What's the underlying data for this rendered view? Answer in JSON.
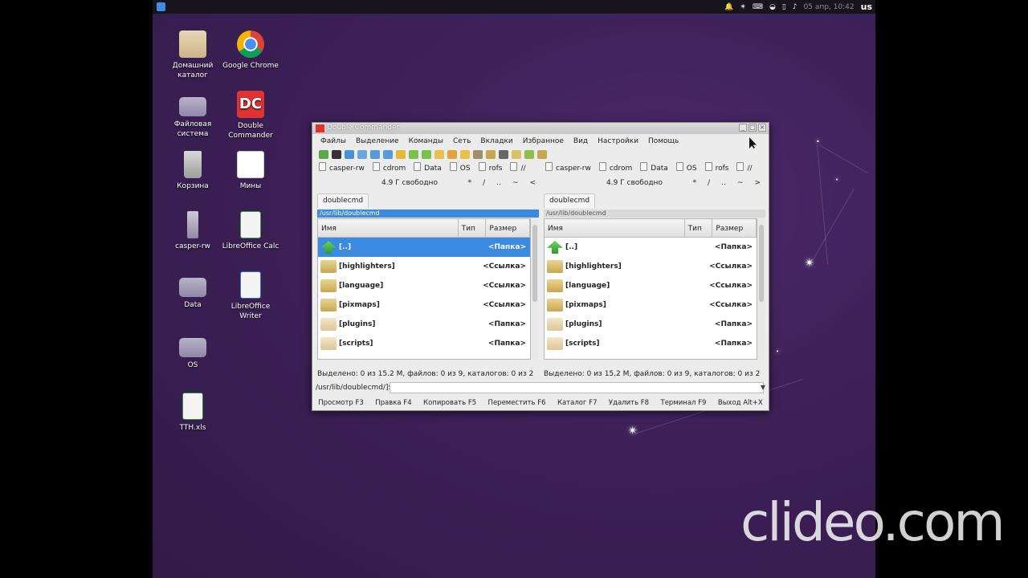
{
  "topbar": {
    "clock": "05 апр, 10:42",
    "lang": "us",
    "tray_icons": [
      "bell-icon",
      "bluetooth-icon",
      "keyboard-icon",
      "wifi-icon",
      "battery-icon",
      "volume-icon"
    ]
  },
  "desktop": {
    "icons": [
      {
        "label": "Домашний каталог",
        "icon": "home-folder-icon"
      },
      {
        "label": "Google Chrome",
        "icon": "chrome-icon"
      },
      {
        "label": "Файловая система",
        "icon": "drive-icon"
      },
      {
        "label": "Double Commander",
        "icon": "double-commander-icon"
      },
      {
        "label": "Корзина",
        "icon": "trash-icon"
      },
      {
        "label": "Мины",
        "icon": "mines-icon"
      },
      {
        "label": "casper-rw",
        "icon": "usb-icon"
      },
      {
        "label": "LibreOffice Calc",
        "icon": "calc-icon"
      },
      {
        "label": "Data",
        "icon": "drive-icon"
      },
      {
        "label": "LibreOffice Writer",
        "icon": "writer-icon"
      },
      {
        "label": "OS",
        "icon": "drive-icon"
      },
      {
        "label": "TTH.xls",
        "icon": "xls-icon"
      }
    ]
  },
  "window": {
    "title": "Double Commander",
    "menu": [
      "Файлы",
      "Выделение",
      "Команды",
      "Сеть",
      "Вкладки",
      "Избранное",
      "Вид",
      "Настройки",
      "Помощь"
    ],
    "drives": [
      "casper-rw",
      "cdrom",
      "Data",
      "OS",
      "rofs",
      "//"
    ],
    "free_space": "4.9 Г свободно",
    "nav": [
      "*",
      "/",
      "..",
      "~",
      "<"
    ],
    "nav_right": [
      "*",
      "/",
      "..",
      "~",
      ">"
    ],
    "left": {
      "tab": "doublecmd",
      "path": "/usr/lib/doublecmd",
      "status": "Выделено: 0 из 15.2 M, файлов: 0 из 9, каталогов: 0 из 2"
    },
    "right": {
      "tab": "doublecmd",
      "path": "/usr/lib/doublecmd",
      "status": "Выделено: 0 из 15.2 M, файлов: 0 из 9, каталогов: 0 из 2"
    },
    "columns": {
      "name": "Имя",
      "type": "Тип",
      "size": "Размер"
    },
    "rows": [
      {
        "name": "[..]",
        "kind": "<Папка>",
        "icon": "up-icon"
      },
      {
        "name": "[highlighters]",
        "kind": "<Ссылка>",
        "icon": "link-folder-icon"
      },
      {
        "name": "[language]",
        "kind": "<Ссылка>",
        "icon": "link-folder-icon"
      },
      {
        "name": "[pixmaps]",
        "kind": "<Ссылка>",
        "icon": "link-folder-icon"
      },
      {
        "name": "[plugins]",
        "kind": "<Папка>",
        "icon": "folder-icon"
      },
      {
        "name": "[scripts]",
        "kind": "<Папка>",
        "icon": "folder-icon"
      }
    ],
    "cmdline": "/usr/lib/doublecmd/]$:",
    "fkeys": [
      "Просмотр F3",
      "Правка F4",
      "Копировать F5",
      "Переместить F6",
      "Каталог F7",
      "Удалить F8",
      "Терминал F9",
      "Выход Alt+X"
    ]
  },
  "watermark": "clideo.com"
}
